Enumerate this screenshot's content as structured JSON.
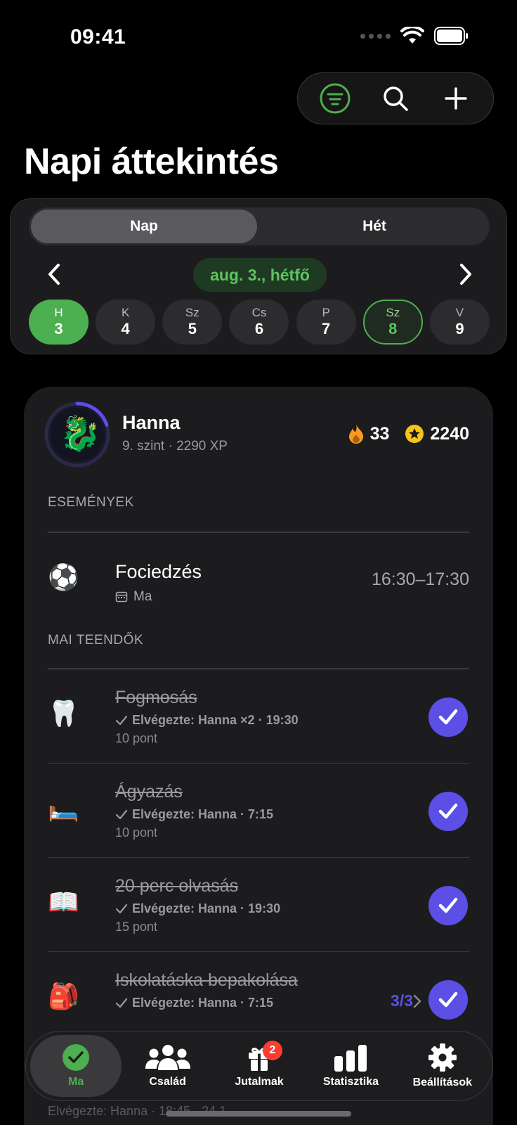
{
  "status": {
    "time": "09:41"
  },
  "header": {
    "title": "Napi áttekintés",
    "actions": [
      "filter-icon",
      "search-icon",
      "plus-icon"
    ]
  },
  "segment": {
    "day_label": "Nap",
    "week_label": "Hét",
    "selected": "Nap"
  },
  "date_nav": {
    "current_date": "aug. 3., hétfő"
  },
  "days": [
    {
      "label": "H",
      "num": "3",
      "state": "selected"
    },
    {
      "label": "K",
      "num": "4",
      "state": "normal"
    },
    {
      "label": "Sz",
      "num": "5",
      "state": "normal"
    },
    {
      "label": "Cs",
      "num": "6",
      "state": "normal"
    },
    {
      "label": "P",
      "num": "7",
      "state": "normal"
    },
    {
      "label": "Sz",
      "num": "8",
      "state": "today"
    },
    {
      "label": "V",
      "num": "9",
      "state": "normal"
    }
  ],
  "user": {
    "name": "Hanna",
    "sub": "9. szint · 2290 XP",
    "level_progress": 0.2,
    "streak": "33",
    "coins": "2240"
  },
  "events_section": {
    "label": "ESEMÉNYEK",
    "items": [
      {
        "emoji": "⚽",
        "title": "Fociedzés",
        "sub": "Ma",
        "time": "16:30–17:30"
      }
    ]
  },
  "tasks_section": {
    "label": "MAI TEENDŐK",
    "items": [
      {
        "emoji": "🦷",
        "title": "Fogmosás",
        "done": "Elvégezte: Hanna ×2 · 19:30",
        "points": "10 pont"
      },
      {
        "emoji": "🛏️",
        "title": "Ágyazás",
        "done": "Elvégezte: Hanna · 7:15",
        "points": "10 pont"
      },
      {
        "emoji": "📖",
        "title": "20 perc olvasás",
        "done": "Elvégezte: Hanna · 19:30",
        "points": "15 pont"
      },
      {
        "emoji": "🎒",
        "title": "Iskolatáska bepakolása",
        "done": "Elvégezte: Hanna · 7:15",
        "points": "",
        "progress": "3/3"
      }
    ],
    "partial_row": "Elvégezte: Hanna · 18:45 · 24,1"
  },
  "tabs": [
    {
      "label": "Ma",
      "icon": "check-circle-icon",
      "active": true
    },
    {
      "label": "Család",
      "icon": "people-icon",
      "active": false
    },
    {
      "label": "Jutalmak",
      "icon": "gift-icon",
      "active": false,
      "badge": "2"
    },
    {
      "label": "Statisztika",
      "icon": "bar-chart-icon",
      "active": false
    },
    {
      "label": "Beállítások",
      "icon": "gear-icon",
      "active": false
    }
  ],
  "colors": {
    "accent_green": "#4caf50",
    "accent_purple": "#5b4fe6",
    "badge_red": "#ff3b30"
  }
}
